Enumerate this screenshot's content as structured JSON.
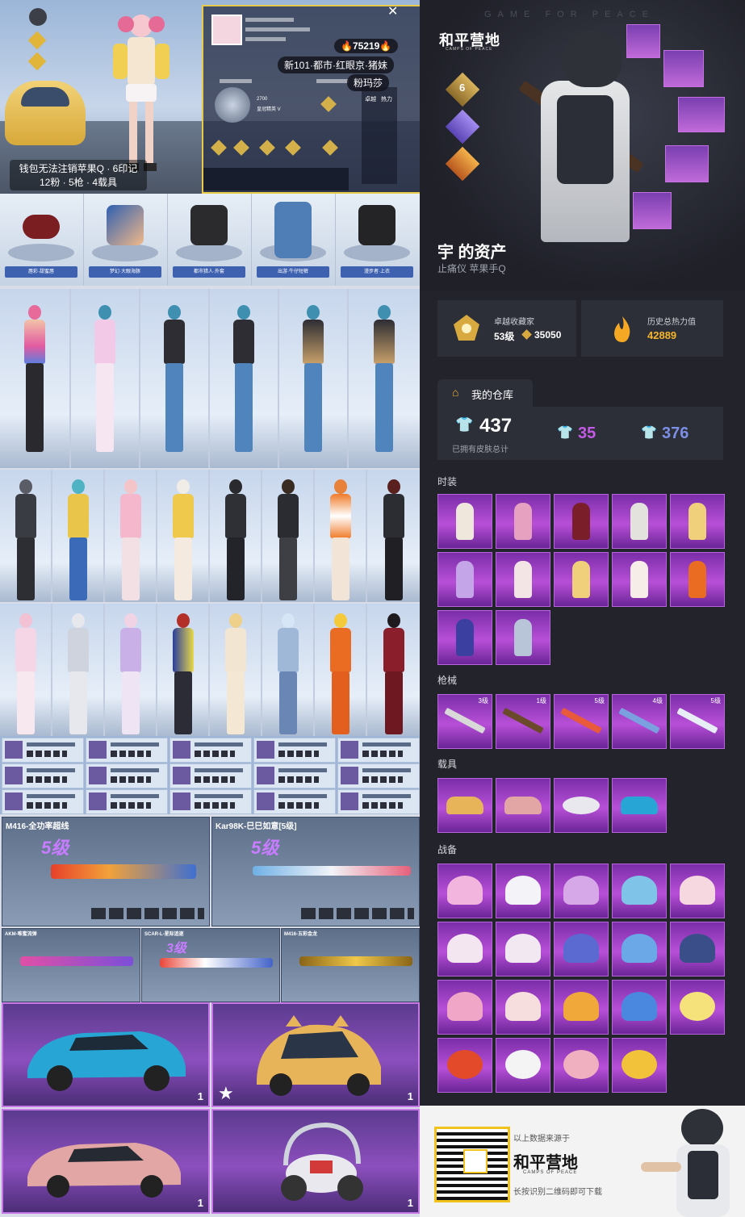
{
  "left": {
    "hero": {
      "caption_line1": "钱包无法注销苹果Q · 6印记",
      "caption_line2": "12粉 · 5枪 · 4载具",
      "coins": "75219",
      "tag1": "新101·都市·红眼京·猪妹",
      "tag2": "粉玛莎"
    },
    "profile": {
      "rank_label": "2700",
      "rank_sub": "皇冠精英 V",
      "stat1": "卓越",
      "stat2": "热力"
    },
    "item_strip": [
      "唇彩·甜蜜唇",
      "梦幻·大眼海豚",
      "都市猎人·外套",
      "出游·牛仔短裤",
      "漫步者·上衣"
    ],
    "guns": {
      "g1": {
        "title": "M416-全功率超线",
        "level": "5级"
      },
      "g2": {
        "title": "Kar98K-巳巳如意[5级]",
        "level": "5级"
      },
      "g3": {
        "title": "AKM-唯蜜流弹",
        "level": ""
      },
      "g4": {
        "title": "SCAR-L-星际追逐",
        "level": "3级"
      },
      "g5": {
        "title": "M416-五彩金龙",
        "level": ""
      }
    },
    "vehicles": {
      "count1": "1",
      "count2": "1",
      "count3": "1",
      "count4": "1"
    }
  },
  "right": {
    "top_word": "GAME FOR PEACE",
    "brand": "和平营地",
    "brand_sub": "CAMPS OF PEACE",
    "badge_level": "6",
    "asset_title": "宇 的资产",
    "asset_sub": "止痛仪   苹果手Q",
    "stat_collector": {
      "label": "卓越收藏家",
      "level": "53级",
      "points": "35050"
    },
    "stat_heat": {
      "label": "历史总热力值",
      "value": "42889"
    },
    "warehouse": {
      "title": "我的仓库",
      "total": "437",
      "total_label": "已拥有皮肤总计",
      "purple": "35",
      "blue": "376"
    },
    "sections": {
      "fashion": "时装",
      "guns": "枪械",
      "vehicles": "载具",
      "gear": "战备"
    },
    "gun_levels": [
      "3级",
      "1级",
      "5级",
      "4级",
      "5级"
    ],
    "footer": {
      "line1": "以上数据来源于",
      "brand": "和平营地",
      "brand_sub": "CAMPS OF PEACE",
      "line2": "长按识别二维码即可下载"
    }
  },
  "colors": {
    "purple_tile": "#b84fd8",
    "gold": "#f5b52b",
    "dark_bg": "#22232b"
  }
}
